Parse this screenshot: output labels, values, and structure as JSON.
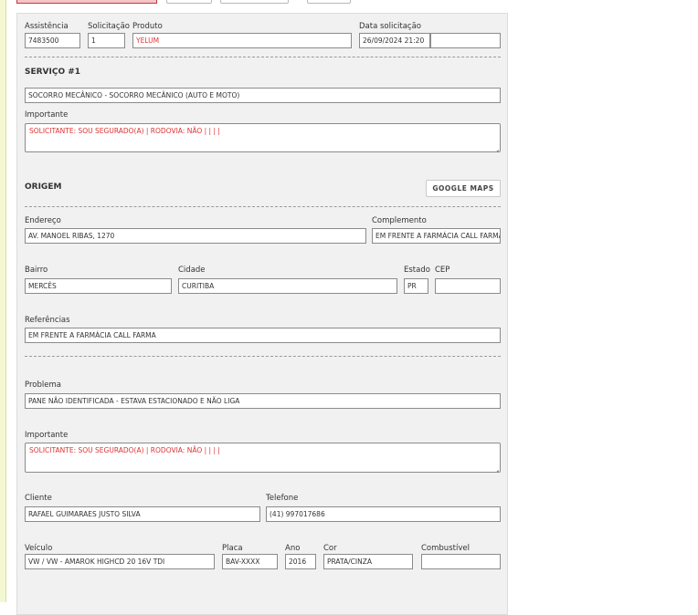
{
  "header": {
    "assistencia_label": "Assistência",
    "assistencia_value": "7483500",
    "solicitacao_label": "Solicitação",
    "solicitacao_value": "1",
    "produto_label": "Produto",
    "produto_value": "YELUM",
    "data_label": "Data solicitação",
    "data_value": "26/09/2024 21:20",
    "data_extra_value": ""
  },
  "servico": {
    "title": "SERVIÇO #1",
    "service_value": "SOCORRO MECÂNICO - SOCORRO MECÂNICO (AUTO E MOTO)",
    "importante_label": "Importante",
    "importante_value": "SOLICITANTE: SOU SEGURADO(A) | RODOVIA: NÃO |  |  |  |"
  },
  "origem": {
    "title": "ORIGEM",
    "google_maps_label": "GOOGLE MAPS",
    "endereco_label": "Endereço",
    "endereco_value": "AV. MANOEL RIBAS, 1270",
    "complemento_label": "Complemento",
    "complemento_value": "EM FRENTE A FARMÁCIA CALL FARMA",
    "bairro_label": "Bairro",
    "bairro_value": "MERCÊS",
    "cidade_label": "Cidade",
    "cidade_value": "CURITIBA",
    "estado_label": "Estado",
    "estado_value": "PR",
    "cep_label": "CEP",
    "cep_value": "",
    "referencias_label": "Referências",
    "referencias_value": "EM FRENTE A FARMÁCIA CALL FARMA"
  },
  "detalhes": {
    "problema_label": "Problema",
    "problema_value": "PANE NÃO IDENTIFICADA - ESTAVA ESTACIONADO E NÃO LIGA",
    "importante_label": "Importante",
    "importante_value": "SOLICITANTE: SOU SEGURADO(A) | RODOVIA: NÃO |  |  |  |",
    "cliente_label": "Cliente",
    "cliente_value": "RAFAEL GUIMARAES JUSTO SILVA",
    "telefone_label": "Telefone",
    "telefone_value": "(41) 997017686",
    "veiculo_label": "Veículo",
    "veiculo_value": "VW / VW - AMAROK HIGHCD 20 16V TDI",
    "placa_label": "Placa",
    "placa_value": "BAV-XXXX",
    "ano_label": "Ano",
    "ano_value": "2016",
    "cor_label": "Cor",
    "cor_value": "PRATA/CINZA",
    "combustivel_label": "Combustível",
    "combustivel_value": ""
  },
  "icons": {
    "top_button_icon": "green-square-icon",
    "resize_handle": "resize-grip-icon"
  },
  "colors": {
    "accent_red": "#dd3333",
    "top_button_red_bg": "#f5c6c6",
    "panel_bg": "#f1f1f1"
  }
}
